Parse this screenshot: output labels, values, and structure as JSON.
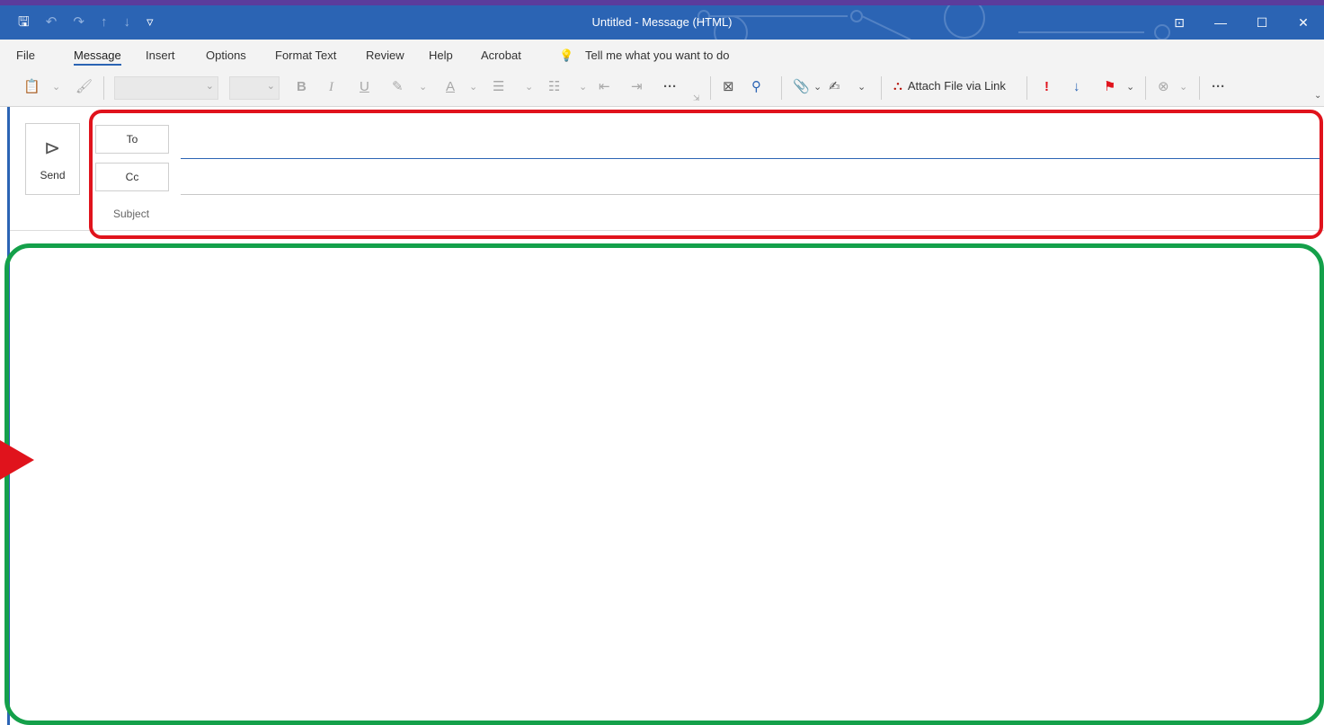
{
  "window": {
    "title": "Untitled - Message (HTML)"
  },
  "menu": {
    "items": [
      "File",
      "Message",
      "Insert",
      "Options",
      "Format Text",
      "Review",
      "Help",
      "Acrobat"
    ],
    "tell_me": "Tell me what you want to do"
  },
  "ribbon": {
    "attach_file_via_link": "Attach File via Link",
    "more": "···"
  },
  "compose": {
    "send_label": "Send",
    "to_label": "To",
    "cc_label": "Cc",
    "subject_label": "Subject"
  },
  "colors": {
    "titlebar": "#2b64b4",
    "annotation_red": "#e0131c",
    "annotation_green": "#14a04a"
  }
}
